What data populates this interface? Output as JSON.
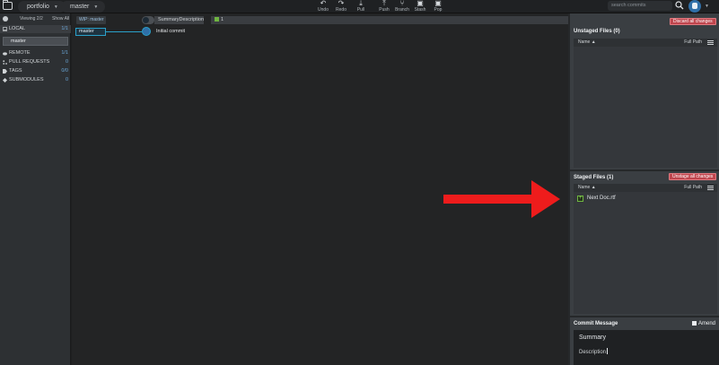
{
  "topbar": {
    "repo": "portfolio",
    "branch": "master",
    "tools": [
      {
        "icon": "undo-icon",
        "glyph": "↶",
        "label": "Undo"
      },
      {
        "icon": "redo-icon",
        "glyph": "↷",
        "label": "Redo"
      },
      {
        "icon": "pull-icon",
        "glyph": "⤓",
        "label": "Pull"
      },
      {
        "icon": "push-icon",
        "glyph": "⤒",
        "label": "Push"
      },
      {
        "icon": "branch-icon",
        "glyph": "⑂",
        "label": "Branch"
      },
      {
        "icon": "stash-icon",
        "glyph": "▣",
        "label": "Stash"
      },
      {
        "icon": "pop-icon",
        "glyph": "▣",
        "label": "Pop"
      }
    ],
    "search_placeholder": "search commits"
  },
  "sidebar": {
    "viewing": "Viewing 2/2",
    "show_all": "Show All",
    "local_label": "LOCAL",
    "local_count": "1/1",
    "branch": "master",
    "sections": [
      {
        "icon": "cloud-icon",
        "label": "REMOTE",
        "count": "1/1"
      },
      {
        "icon": "pull-request-icon",
        "label": "PULL REQUESTS",
        "count": "0"
      },
      {
        "icon": "tag-icon",
        "label": "TAGS",
        "count": "0/0"
      },
      {
        "icon": "submodule-icon",
        "label": "SUBMODULES",
        "count": "0"
      }
    ]
  },
  "graph": {
    "wip_label": "WIP: master",
    "summary_header": "SummaryDescription",
    "file_count": "1",
    "branch_chip": "master",
    "commit_message": "Initial commit"
  },
  "right_panel": {
    "discard_label": "Discard all changes",
    "unstaged_title": "Unstaged Files (0)",
    "name_col": "Name",
    "path_col": "Full Path",
    "unstage_label": "Unstage all changes",
    "staged_title": "Staged Files (1)",
    "staged_files": [
      "Next Doc.rtf"
    ],
    "commit_title": "Commit Message",
    "amend_label": "Amend",
    "summary_text": "Summary",
    "description_text": "Description"
  },
  "colors": {
    "accent": "#2aa0c9",
    "danger": "#c0464e",
    "added": "#6fb541",
    "annotation": "#ee1c1c"
  }
}
